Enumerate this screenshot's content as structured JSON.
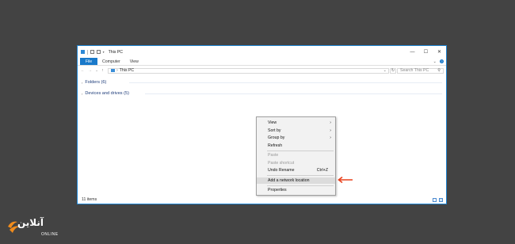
{
  "window": {
    "title": "This PC",
    "controls": {
      "minimize": "—",
      "maximize": "☐",
      "close": "✕"
    }
  },
  "ribbon": {
    "tabs": [
      "File",
      "Computer",
      "View"
    ],
    "collapse": "⌄",
    "help": "?"
  },
  "address": {
    "back": "←",
    "forward": "→",
    "recent": "⌄",
    "up": "↑",
    "separator": "›",
    "path": "This PC",
    "dropdown": "⌄",
    "refresh": "↻",
    "search_placeholder": "Search This PC",
    "search_icon": "⚲"
  },
  "groups": [
    {
      "label": "Folders (6)",
      "chevron": "›"
    },
    {
      "label": "Devices and drives (5)",
      "chevron": "›"
    }
  ],
  "status": {
    "item_count": "11 items"
  },
  "context_menu": {
    "view": "View",
    "sort_by": "Sort by",
    "group_by": "Group by",
    "refresh": "Refresh",
    "paste": "Paste",
    "paste_shortcut": "Paste shortcut",
    "undo_rename": "Undo Rename",
    "undo_shortcut": "Ctrl+Z",
    "add_network_location": "Add a network location",
    "properties": "Properties",
    "submenu_glyph": "›"
  },
  "logo": {
    "text": "آنلاین",
    "sub": "ONLINE"
  },
  "colors": {
    "accent": "#1979ca",
    "arrow": "#e8401c",
    "background": "#434343",
    "logo_orange": "#f28c1c"
  }
}
